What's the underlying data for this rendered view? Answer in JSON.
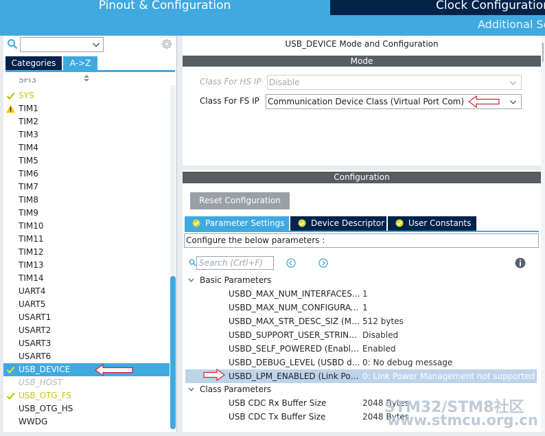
{
  "header": {
    "tab_pinout": "Pinout & Configuration",
    "tab_clock": "Clock Configuration",
    "additional": "Additional Sof"
  },
  "left": {
    "search_value": "",
    "tab_categories": "Categories",
    "tab_az": "A->Z",
    "items": [
      {
        "label": "SYS",
        "state": "ok-yellow"
      },
      {
        "label": "TIM1",
        "state": "warning"
      },
      {
        "label": "TIM2",
        "state": "normal"
      },
      {
        "label": "TIM3",
        "state": "normal"
      },
      {
        "label": "TIM4",
        "state": "normal"
      },
      {
        "label": "TIM5",
        "state": "normal"
      },
      {
        "label": "TIM6",
        "state": "normal"
      },
      {
        "label": "TIM7",
        "state": "normal"
      },
      {
        "label": "TIM8",
        "state": "normal"
      },
      {
        "label": "TIM9",
        "state": "normal"
      },
      {
        "label": "TIM10",
        "state": "normal"
      },
      {
        "label": "TIM11",
        "state": "normal"
      },
      {
        "label": "TIM12",
        "state": "normal"
      },
      {
        "label": "TIM13",
        "state": "normal"
      },
      {
        "label": "TIM14",
        "state": "normal"
      },
      {
        "label": "UART4",
        "state": "normal"
      },
      {
        "label": "UART5",
        "state": "normal"
      },
      {
        "label": "USART1",
        "state": "normal"
      },
      {
        "label": "USART2",
        "state": "normal"
      },
      {
        "label": "USART3",
        "state": "normal"
      },
      {
        "label": "USART6",
        "state": "normal"
      },
      {
        "label": "USB_DEVICE",
        "state": "selected"
      },
      {
        "label": "USB_HOST",
        "state": "disabled"
      },
      {
        "label": "USB_OTG_FS",
        "state": "ok-yellow"
      },
      {
        "label": "USB_OTG_HS",
        "state": "normal"
      },
      {
        "label": "WWDG",
        "state": "normal"
      }
    ]
  },
  "mode": {
    "title": "USB_DEVICE Mode and Configuration",
    "bar": "Mode",
    "hs_label": "Class For HS IP",
    "hs_value": "Disable",
    "fs_label": "Class For FS IP",
    "fs_value": "Communication Device Class (Virtual Port Com)"
  },
  "config": {
    "bar": "Configuration",
    "reset": "Reset Configuration",
    "tabs": [
      "Parameter Settings",
      "Device Descriptor",
      "User Constants"
    ],
    "description": "Configure the below parameters :",
    "search_placeholder": "Search (Crtl+F)",
    "groups": [
      {
        "name": "Basic Parameters",
        "params": [
          {
            "name": "USBD_MAX_NUM_INTERFACES (Maximum number of supported interfaces)",
            "value": "1"
          },
          {
            "name": "USBD_MAX_NUM_CONFIGURATION (Maximum number of supported configuration)",
            "value": "1"
          },
          {
            "name": "USBD_MAX_STR_DESC_SIZ (Maximum size for the string descriptors)",
            "value": "512 bytes"
          },
          {
            "name": "USBD_SUPPORT_USER_STRING (Enable user string support)",
            "value": "Disabled"
          },
          {
            "name": "USBD_SELF_POWERED (Enabled self power)",
            "value": "Enabled"
          },
          {
            "name": "USBD_DEBUG_LEVEL (USBD debug level)",
            "value": "0: No debug message"
          },
          {
            "name": "USBD_LPM_ENABLED (Link Power Management)",
            "value": "0: Link Power Management not supported"
          }
        ]
      },
      {
        "name": "Class Parameters",
        "params": [
          {
            "name": "USB CDC Rx Buffer Size",
            "value": "2048 Bytes"
          },
          {
            "name": "USB CDC Tx Buffer Size",
            "value": "2048 Bytes"
          }
        ]
      }
    ]
  },
  "watermark": {
    "line1": "STM32/STM8社区",
    "line2": "www.stmcu.org.cn"
  },
  "colors": {
    "accent": "#3fa9e0",
    "dark_navy": "#03234b",
    "ok_yellow": "#c6c60e",
    "warning": "#f5c400",
    "red_arrow": "#d8202a"
  }
}
